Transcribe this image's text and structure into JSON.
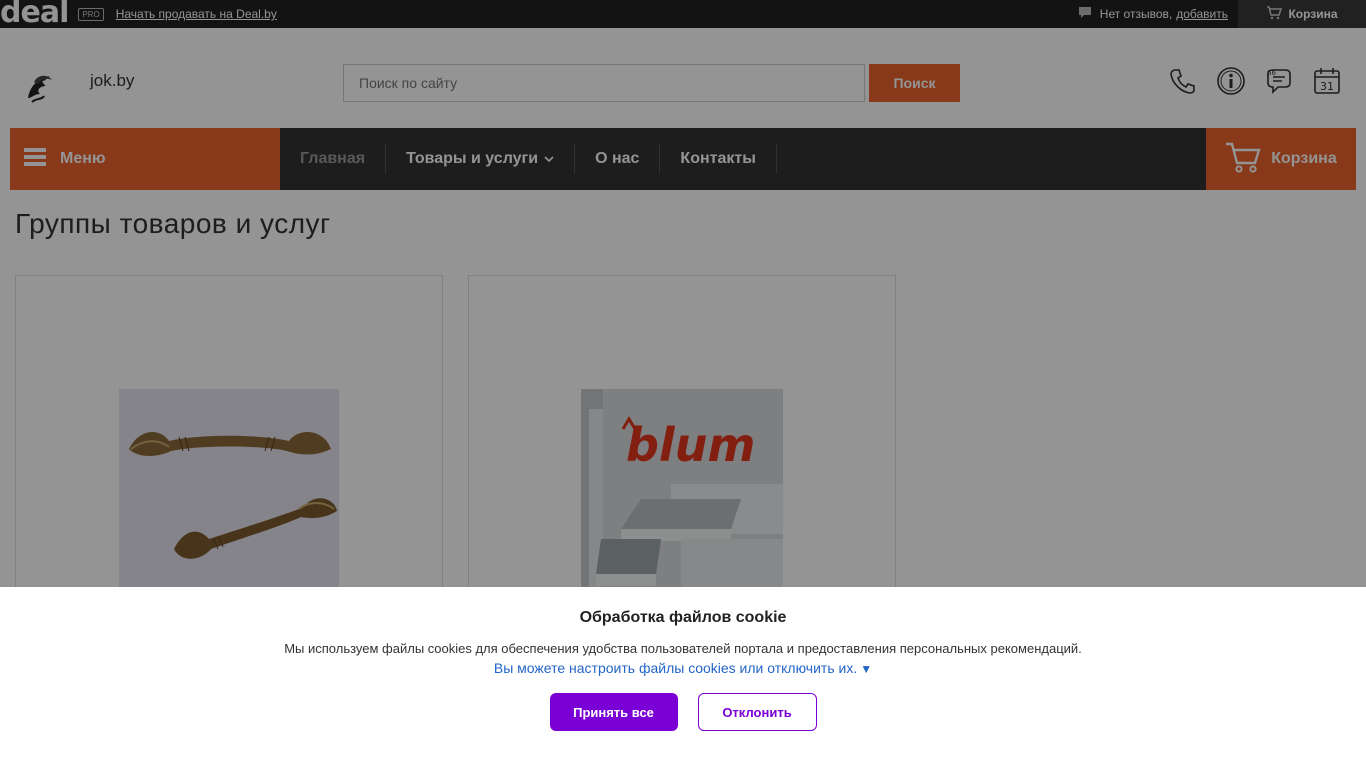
{
  "topbar": {
    "logo": "deal",
    "pro_badge": "PRO",
    "sell_link": "Начать продавать на Deal.by",
    "reviews_text": "Нет отзывов,",
    "reviews_link": "добавить",
    "cart_label": "Корзина"
  },
  "header": {
    "site_name": "jok.by",
    "search_placeholder": "Поиск по сайту",
    "search_button": "Поиск",
    "calendar_day": "31",
    "icons": [
      "phone-icon",
      "info-icon",
      "reviews-icon",
      "calendar-icon"
    ]
  },
  "nav": {
    "menu_label": "Меню",
    "items": [
      "Главная",
      "Товары и услуги",
      "О нас",
      "Контакты"
    ],
    "cart_label": "Корзина"
  },
  "main": {
    "title": "Группы товаров и услуг",
    "cards": [
      {
        "image": "furniture-handles-image"
      },
      {
        "image": "blum-drawers-image",
        "brand_text": "blum"
      }
    ]
  },
  "cookie": {
    "title": "Обработка файлов cookie",
    "text": "Мы используем файлы cookies для обеспечения удобства пользователей портала и предоставления персональных рекомендаций.",
    "link": "Вы можете настроить файлы cookies или отключить их.",
    "link_arrow": "▼",
    "accept": "Принять все",
    "decline": "Отклонить"
  },
  "colors": {
    "accent": "#e8632b",
    "dark": "#333333",
    "cookie_primary": "#7b00d6",
    "link": "#2366c9"
  }
}
